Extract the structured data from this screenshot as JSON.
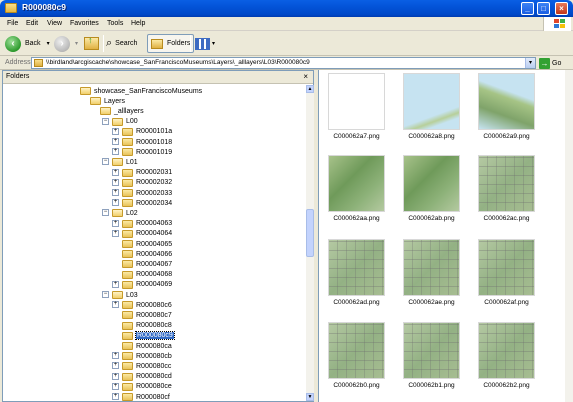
{
  "window": {
    "title": "R000080c9"
  },
  "menu": [
    "File",
    "Edit",
    "View",
    "Favorites",
    "Tools",
    "Help"
  ],
  "toolbar": {
    "back": "Back",
    "search": "Search",
    "folders": "Folders"
  },
  "address": {
    "label": "Address",
    "value": "\\\\birdland\\arcgiscache\\showcase_SanFranciscoMuseums\\Layers\\_alllayers\\L03\\R000080c9",
    "go": "Go"
  },
  "folders_pane": {
    "title": "Folders"
  },
  "tree": [
    {
      "label": "showcase_SanFranciscoMuseums",
      "level": 0,
      "open": true
    },
    {
      "label": "Layers",
      "level": 1,
      "open": true
    },
    {
      "label": "_alllayers",
      "level": 2,
      "open": true
    },
    {
      "label": "L00",
      "level": 3,
      "open": true
    },
    {
      "label": "R0000101a",
      "level": 4,
      "plus": true
    },
    {
      "label": "R00001018",
      "level": 4,
      "plus": true
    },
    {
      "label": "R00001019",
      "level": 4,
      "plus": true
    },
    {
      "label": "L01",
      "level": 3,
      "open": true
    },
    {
      "label": "R00002031",
      "level": 4,
      "plus": true
    },
    {
      "label": "R00002032",
      "level": 4,
      "plus": true
    },
    {
      "label": "R00002033",
      "level": 4,
      "plus": true
    },
    {
      "label": "R00002034",
      "level": 4,
      "plus": true
    },
    {
      "label": "L02",
      "level": 3,
      "open": true
    },
    {
      "label": "R00004063",
      "level": 4,
      "plus": true
    },
    {
      "label": "R00004064",
      "level": 4,
      "plus": true
    },
    {
      "label": "R00004065",
      "level": 4
    },
    {
      "label": "R00004066",
      "level": 4
    },
    {
      "label": "R00004067",
      "level": 4
    },
    {
      "label": "R00004068",
      "level": 4
    },
    {
      "label": "R00004069",
      "level": 4,
      "plus": true
    },
    {
      "label": "L03",
      "level": 3,
      "open": true
    },
    {
      "label": "R000080c6",
      "level": 4,
      "plus": true
    },
    {
      "label": "R000080c7",
      "level": 4
    },
    {
      "label": "R000080c8",
      "level": 4
    },
    {
      "label": "R000080c9",
      "level": 4,
      "selected": true
    },
    {
      "label": "R000080ca",
      "level": 4
    },
    {
      "label": "R000080cb",
      "level": 4,
      "plus": true
    },
    {
      "label": "R000080cc",
      "level": 4,
      "plus": true
    },
    {
      "label": "R000080cd",
      "level": 4,
      "plus": true
    },
    {
      "label": "R000080ce",
      "level": 4,
      "plus": true
    },
    {
      "label": "R000080cf",
      "level": 4,
      "plus": true
    }
  ],
  "files": [
    {
      "name": "C000062a7.png",
      "style": "blank"
    },
    {
      "name": "C000062a8.png",
      "style": "sky"
    },
    {
      "name": "C000062a9.png",
      "style": "skygreen"
    },
    {
      "name": "C000062aa.png",
      "style": "green"
    },
    {
      "name": "C000062ab.png",
      "style": "green"
    },
    {
      "name": "C000062ac.png",
      "style": "grid"
    },
    {
      "name": "C000062ad.png",
      "style": "grid"
    },
    {
      "name": "C000062ae.png",
      "style": "grid"
    },
    {
      "name": "C000062af.png",
      "style": "grid"
    },
    {
      "name": "C000062b0.png",
      "style": "grid"
    },
    {
      "name": "C000062b1.png",
      "style": "grid"
    },
    {
      "name": "C000062b2.png",
      "style": "grid"
    }
  ]
}
